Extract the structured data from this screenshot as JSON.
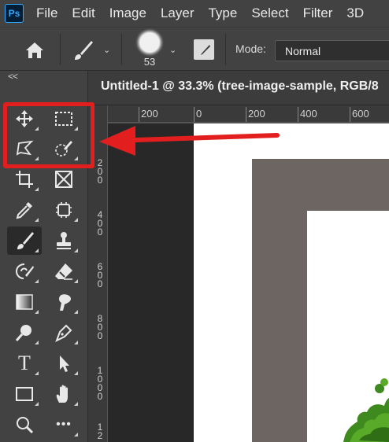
{
  "app": {
    "logo_text": "Ps"
  },
  "menu": {
    "items": [
      "File",
      "Edit",
      "Image",
      "Layer",
      "Type",
      "Select",
      "Filter",
      "3D"
    ]
  },
  "options_bar": {
    "home_icon": "home-icon",
    "tool_icon": "brush-icon",
    "brush_size": "53",
    "mode_label": "Mode:",
    "mode_value": "Normal"
  },
  "toolbar": {
    "collapse_label": "<<",
    "tools": [
      {
        "name": "move-tool",
        "icon": "move-icon"
      },
      {
        "name": "rectangular-marquee-tool",
        "icon": "marquee-icon"
      },
      {
        "name": "lasso-tool",
        "icon": "lasso-icon"
      },
      {
        "name": "quick-selection-tool",
        "icon": "quick-selection-icon"
      },
      {
        "name": "crop-tool",
        "icon": "crop-icon"
      },
      {
        "name": "frame-tool",
        "icon": "frame-icon"
      },
      {
        "name": "eyedropper-tool",
        "icon": "eyedropper-icon"
      },
      {
        "name": "spot-healing-tool",
        "icon": "healing-icon"
      },
      {
        "name": "brush-tool",
        "icon": "brush-icon",
        "active": true
      },
      {
        "name": "clone-stamp-tool",
        "icon": "stamp-icon"
      },
      {
        "name": "history-brush-tool",
        "icon": "history-brush-icon"
      },
      {
        "name": "eraser-tool",
        "icon": "eraser-icon"
      },
      {
        "name": "gradient-tool",
        "icon": "gradient-icon"
      },
      {
        "name": "smudge-tool",
        "icon": "smudge-icon"
      },
      {
        "name": "dodge-tool",
        "icon": "dodge-icon"
      },
      {
        "name": "pen-tool",
        "icon": "pen-icon"
      },
      {
        "name": "type-tool",
        "icon": "type-icon",
        "label": "T"
      },
      {
        "name": "path-selection-tool",
        "icon": "arrow-icon"
      },
      {
        "name": "rectangle-tool",
        "icon": "rectangle-icon"
      },
      {
        "name": "hand-tool",
        "icon": "hand-icon"
      },
      {
        "name": "zoom-tool",
        "icon": "zoom-icon"
      },
      {
        "name": "edit-toolbar",
        "icon": "more-icon",
        "label": "•••"
      }
    ]
  },
  "document": {
    "tab_title": "Untitled-1 @ 33.3% (tree-image-sample, RGB/8"
  },
  "rulers": {
    "top_labels": [
      "200",
      "0",
      "200",
      "400",
      "600"
    ],
    "left_labels": [
      "2\n0\n0",
      "4\n0\n0",
      "6\n0\n0",
      "8\n0\n0",
      "1\n0\n0\n0",
      "1\n2"
    ]
  },
  "colors": {
    "highlight": "#e31e1e",
    "ui_dark": "#424242",
    "canvas": "#ffffff",
    "frame": "#6c6562"
  }
}
